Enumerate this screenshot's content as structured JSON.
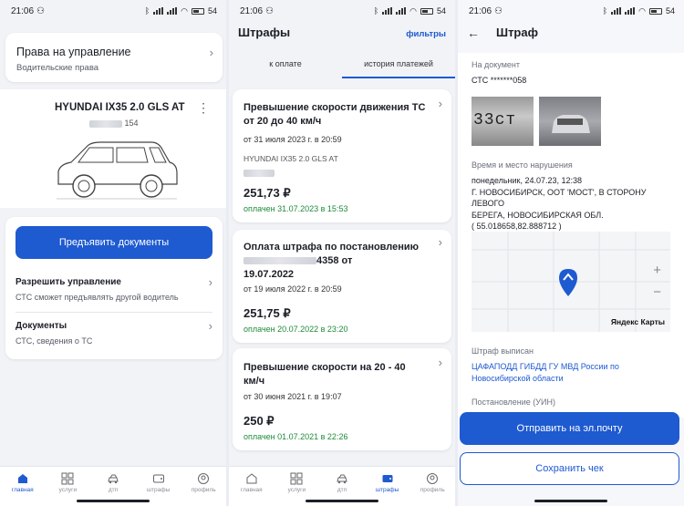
{
  "status": {
    "time": "21:06",
    "battery": "54"
  },
  "screen1": {
    "license_card": {
      "title": "Права на управление",
      "subtitle": "Водительские права"
    },
    "vehicle": {
      "name": "HYUNDAI IX35 2.0 GLS AT",
      "plate_suffix": "154"
    },
    "present_button": "Предъявить документы",
    "allow": {
      "title": "Разрешить управление",
      "subtitle": "СТС сможет предъявлять другой водитель"
    },
    "docs": {
      "title": "Документы",
      "subtitle": "СТС, сведения о ТС"
    }
  },
  "screen2": {
    "title": "Штрафы",
    "filters": "фильтры",
    "tabs": [
      "к оплате",
      "история платежей"
    ],
    "fines": [
      {
        "title": "Превышение скорости движения ТС от 20 до 40 км/ч",
        "date": "от 31 июля 2023 г. в 20:59",
        "vehicle": "HYUNDAI IX35 2.0 GLS AT",
        "amount": "251,73 ₽",
        "paid": "оплачен 31.07.2023 в 15:53"
      },
      {
        "title_start": "Оплата штрафа по постановлению",
        "title_num": "4358 от",
        "title_end": "19.07.2022",
        "date": "от 19 июля 2022 г. в 20:59",
        "amount": "251,75 ₽",
        "paid": "оплачен 20.07.2022 в 23:20"
      },
      {
        "title": "Превышение скорости на 20 - 40 км/ч",
        "date": "от 30 июня 2021 г. в 19:07",
        "amount": "250 ₽",
        "paid": "оплачен 01.07.2021 в 22:26"
      }
    ]
  },
  "tabbar": [
    "главная",
    "услуги",
    "дтп",
    "штрафы",
    "профиль"
  ],
  "screen3": {
    "title": "Штраф",
    "doc_label": "На документ",
    "doc_value": "СТС *******058",
    "photo_text": "33ст",
    "place_label": "Время и место нарушения",
    "place_lines": [
      "понедельник, 24.07.23, 12:38",
      "Г. НОВОСИБИРСК, ООТ 'МОСТ', В СТОРОНУ ЛЕВОГО",
      "БЕРЕГА, НОВОСИБИРСКАЯ ОБЛ.",
      "( 55.018658,82.888712 )"
    ],
    "map_brand": "Яндекс Карты",
    "zoom_in": "+",
    "zoom_out": "−",
    "issuer_label": "Штраф выписан",
    "issuer_lines": [
      "ЦАФАПОДД ГИБДД ГУ МВД России по",
      "Новосибирской области"
    ],
    "decree_label": "Постановление (УИН)",
    "email_button": "Отправить на эл.почту",
    "save_button": "Сохранить чек"
  },
  "colors": {
    "accent": "#1e5ad0",
    "paid": "#1d8a3a"
  }
}
